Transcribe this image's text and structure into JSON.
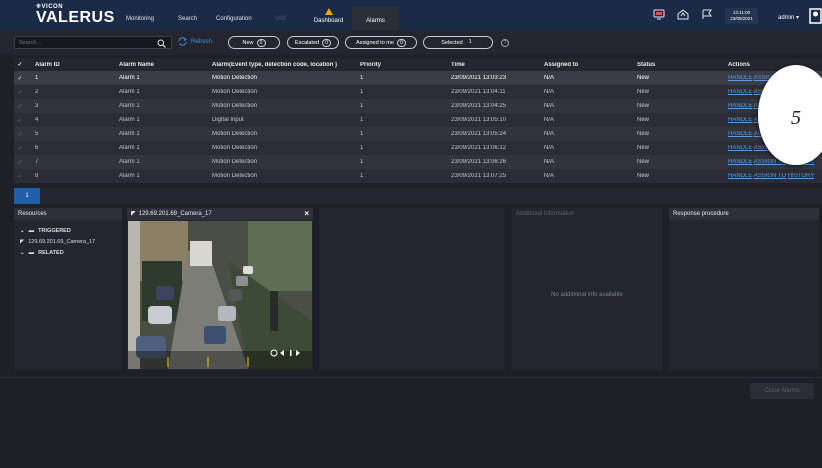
{
  "header": {
    "brand_small": "VICON",
    "brand_big": "VALERUS",
    "nav": [
      "Monitoring",
      "Search",
      "Configuration",
      "VAX",
      "Dashboard",
      "Alarms"
    ],
    "clock_time": "13:11:00",
    "clock_date": "23/09/2021",
    "user": "admin ▾"
  },
  "filters": {
    "search_placeholder": "Search...",
    "refresh": "Refresh",
    "new_label": "New",
    "new_count": "0",
    "escalated_label": "Escalated",
    "escalated_count": "0",
    "assigned_label": "Assigned to me",
    "assigned_count": "0",
    "selected_label": "Selected",
    "selected_count": "1",
    "help": "?"
  },
  "table": {
    "headers": [
      "Alarm ID",
      "Alarm Name",
      "Alarm(Event type, detection code, location )",
      "Priority",
      "Time",
      "Assigned to",
      "Status",
      "Actions"
    ],
    "rows": [
      {
        "id": "1",
        "name": "Alarm 1",
        "event": "Motion Detection",
        "priority": "1",
        "time": "23/09/2021 13:03:23",
        "assigned": "N/A",
        "status": "New"
      },
      {
        "id": "2",
        "name": "Alarm 1",
        "event": "Motion Detection",
        "priority": "1",
        "time": "23/09/2021 13:04:11",
        "assigned": "N/A",
        "status": "New"
      },
      {
        "id": "3",
        "name": "Alarm 1",
        "event": "Motion Detection",
        "priority": "1",
        "time": "23/09/2021 13:04:25",
        "assigned": "N/A",
        "status": "New"
      },
      {
        "id": "4",
        "name": "Alarm 1",
        "event": "Digital Input",
        "priority": "1",
        "time": "23/09/2021 13:05:10",
        "assigned": "N/A",
        "status": "New"
      },
      {
        "id": "5",
        "name": "Alarm 1",
        "event": "Motion Detection",
        "priority": "1",
        "time": "23/09/2021 13:05:24",
        "assigned": "N/A",
        "status": "New"
      },
      {
        "id": "6",
        "name": "Alarm 1",
        "event": "Motion Detection",
        "priority": "1",
        "time": "23/09/2021 13:06:12",
        "assigned": "N/A",
        "status": "New"
      },
      {
        "id": "7",
        "name": "Alarm 1",
        "event": "Motion Detection",
        "priority": "1",
        "time": "23/09/2021 13:06:26",
        "assigned": "N/A",
        "status": "New"
      },
      {
        "id": "8",
        "name": "Alarm 1",
        "event": "Motion Detection",
        "priority": "1",
        "time": "23/09/2021 13:07:25",
        "assigned": "N/A",
        "status": "New"
      }
    ],
    "actions": {
      "handle": "HANDLE",
      "assign": "ASSIGN TO",
      "history": "HISTORY"
    },
    "page": "1"
  },
  "resources": {
    "title": "Resources",
    "triggered": "TRIGGERED",
    "camera": "129.69.201.69_Camera_17",
    "related": "RELATED"
  },
  "camera_panel": {
    "title": "129.69.201.69_Camera_17"
  },
  "info_panel": {
    "title": "Additional information",
    "empty": "No additional info available"
  },
  "response_panel": {
    "title": "Response procedure"
  },
  "footer": {
    "close_alarms": "Close Alarms"
  },
  "callout": {
    "number": "5"
  },
  "colors": {
    "accent": "#1f5ea8",
    "link": "#5b9be6",
    "warning": "#f0a500",
    "topbar": "#1b2a47"
  }
}
